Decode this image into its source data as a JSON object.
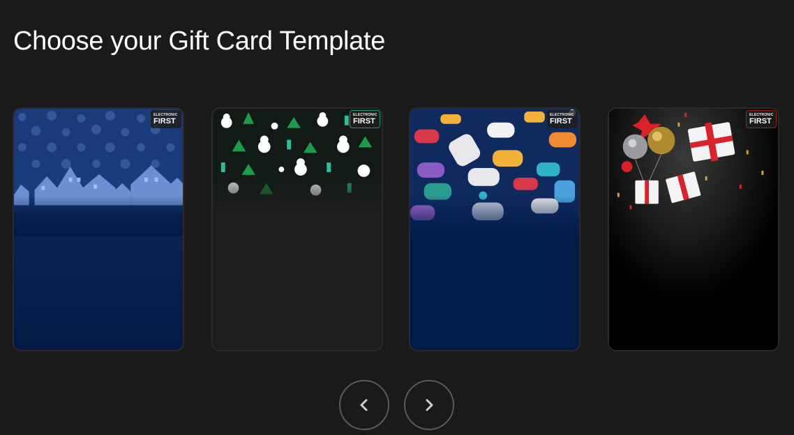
{
  "page": {
    "title": "Choose your Gift Card Template"
  },
  "brand": {
    "logo_top": "ELECTRONIC",
    "logo_main": "FIRST"
  },
  "templates": [
    {
      "theme": "snowy-village-night",
      "base_color": "#021a45"
    },
    {
      "theme": "christmas-pattern",
      "base_color": "#1e1e1e"
    },
    {
      "theme": "gaming-controllers",
      "base_color": "#021c4a"
    },
    {
      "theme": "gifts-and-balloons",
      "base_color": "#000000"
    }
  ],
  "navigation": {
    "prev_icon": "chevron-left-icon",
    "next_icon": "chevron-right-icon"
  }
}
